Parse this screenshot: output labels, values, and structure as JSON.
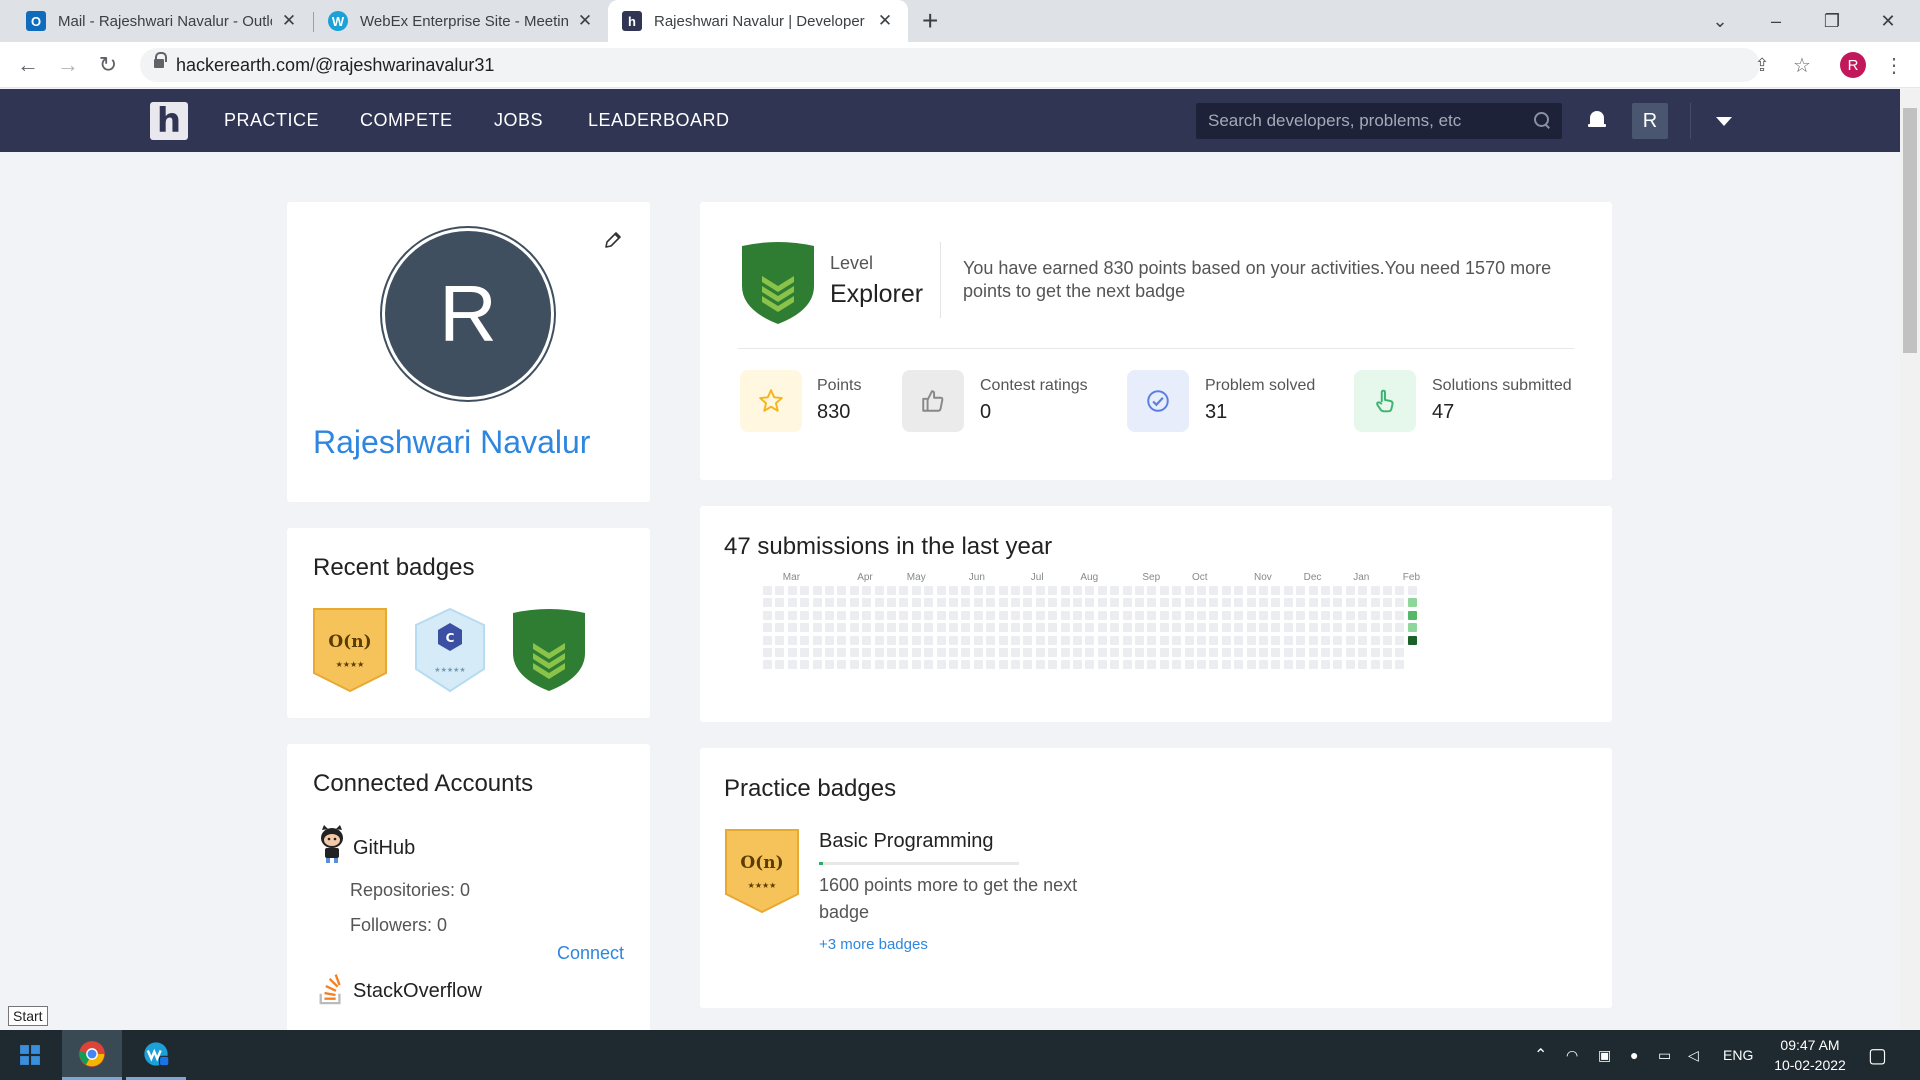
{
  "browser": {
    "tabs": [
      {
        "title": "Mail - Rajeshwari Navalur - Outlo",
        "icon": "outlook-icon",
        "color": "#0f6cbd"
      },
      {
        "title": "WebEx Enterprise Site - Meeting",
        "icon": "webex-icon",
        "color": "#1ba0d7"
      },
      {
        "title": "Rajeshwari Navalur | Developer P",
        "icon": "hackerearth-icon",
        "color": "#2f3553"
      }
    ],
    "url": "hackerearth.com/@rajeshwarinavalur31",
    "profile_initial": "R"
  },
  "site": {
    "logo": "h",
    "nav": [
      "PRACTICE",
      "COMPETE",
      "JOBS",
      "LEADERBOARD"
    ],
    "search_placeholder": "Search developers, problems, etc",
    "avatar_initial": "R"
  },
  "profile": {
    "initial": "R",
    "name": "Rajeshwari Navalur"
  },
  "recent_badges": {
    "title": "Recent badges",
    "badges": [
      {
        "label": "O(n)",
        "stars": "★★★★",
        "color": "#f6c35b"
      },
      {
        "label": "C",
        "stars": "★★★★★",
        "color": "#d5ecf8"
      },
      {
        "label": "",
        "stars": "",
        "color": "#2e7d32"
      }
    ]
  },
  "level": {
    "label": "Level",
    "value": "Explorer",
    "message": "You have earned 830 points based on your activities.You need 1570 more points to get the next badge"
  },
  "stats": [
    {
      "label": "Points",
      "value": "830",
      "icon": "star-icon",
      "bg": "#fff7e0",
      "fg": "#f5b51f"
    },
    {
      "label": "Contest ratings",
      "value": "0",
      "icon": "thumbs-up-icon",
      "bg": "#ebebeb",
      "fg": "#888888"
    },
    {
      "label": "Problem solved",
      "value": "31",
      "icon": "check-circle-icon",
      "bg": "#e8edfc",
      "fg": "#5b7fe0"
    },
    {
      "label": "Solutions submitted",
      "value": "47",
      "icon": "hand-pointer-icon",
      "bg": "#e6f7ec",
      "fg": "#3cb371"
    }
  ],
  "activity": {
    "title": "47 submissions in the last year",
    "months": [
      "Mar",
      "Apr",
      "May",
      "Jun",
      "Jul",
      "Aug",
      "Sep",
      "Oct",
      "Nov",
      "Dec",
      "Jan",
      "Feb"
    ],
    "active_cells": [
      {
        "week": 52,
        "day": 1,
        "level": 1
      },
      {
        "week": 52,
        "day": 2,
        "level": 2
      },
      {
        "week": 52,
        "day": 3,
        "level": 1
      },
      {
        "week": 52,
        "day": 4,
        "level": 4
      }
    ],
    "colors": [
      "#ebedf0",
      "#8fd69a",
      "#55b868",
      "#2e9f4a",
      "#196127"
    ]
  },
  "practice_badges": {
    "title": "Practice badges",
    "badge": {
      "label": "O(n)",
      "stars": "★★★★",
      "color": "#f6c35b"
    },
    "name": "Basic Programming",
    "progress": 0.02,
    "description": "1600 points more to get the next badge",
    "more": "+3 more badges"
  },
  "connected": {
    "title": "Connected Accounts",
    "accounts": [
      {
        "name": "GitHub",
        "icon": "github-icon",
        "repos": "Repositories: 0",
        "followers": "Followers: 0",
        "action": "Connect"
      },
      {
        "name": "StackOverflow",
        "icon": "stackoverflow-icon"
      }
    ]
  },
  "tooltip": "Start",
  "taskbar": {
    "time": "09:47 AM",
    "date": "10-02-2022",
    "lang": "ENG"
  }
}
